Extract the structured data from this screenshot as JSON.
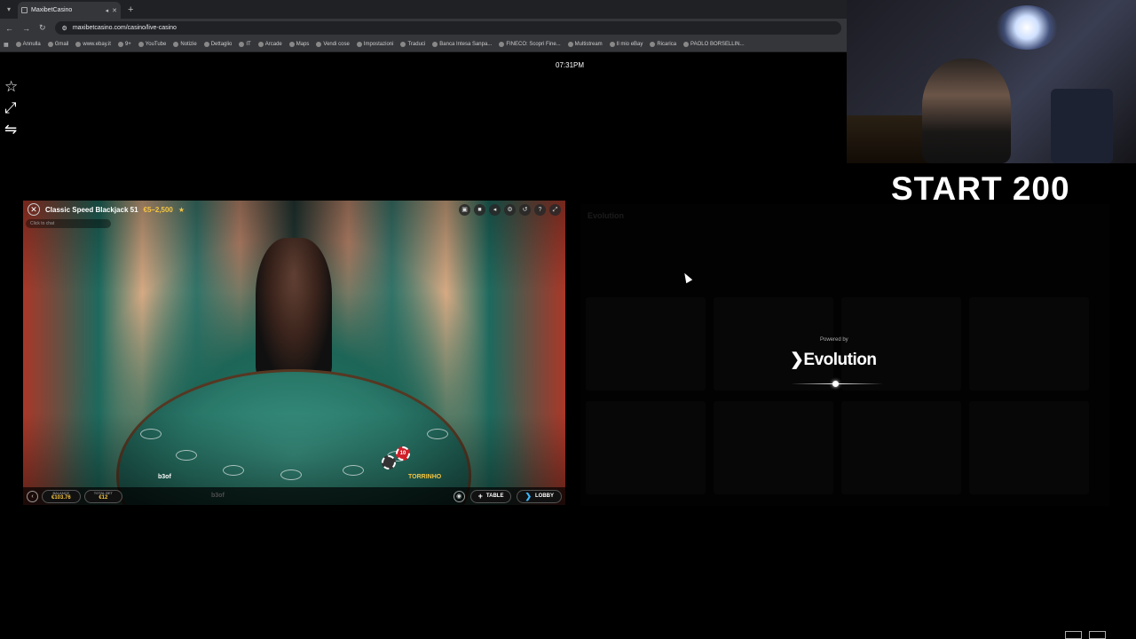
{
  "browser": {
    "tab_title": "MaxibetCasino",
    "url": "maxibetcasino.com/casino/live-casino",
    "bookmarks": [
      "Annulla",
      "Gmail",
      "www.ebay.it",
      "9+",
      "YouTube",
      "Notizie",
      "Dettaglio",
      "IT",
      "Arcade",
      "Maps",
      "Vendi cose",
      "Impostazioni",
      "Traduci",
      "Banca Intesa Sanpa...",
      "FINECO: Scopri Fine...",
      "Multistream",
      "Il mio eBay",
      "Ricarica",
      "PAOLO BORSELLIN..."
    ]
  },
  "clock": "07:31PM",
  "overlay": {
    "start_text": "START 200"
  },
  "game": {
    "title": "Classic Speed Blackjack 51",
    "limits": "€5–2,500",
    "chat_placeholder": "Click to chat",
    "seats": [
      {
        "name": "b3of"
      },
      {
        "name": "b3of"
      },
      {
        "name": "TORRINHO"
      }
    ],
    "chip_value": "10",
    "balance_label": "BALANCE",
    "balance_value": "€103.76",
    "total_bet_label": "TOTAL BET",
    "total_bet_value": "€12",
    "table_button": "TABLE",
    "lobby_button": "LOBBY"
  },
  "loading": {
    "ghost_logo": "Evolution",
    "powered_by": "Powered by",
    "logo_text": "Evolution"
  },
  "colors": {
    "accent_gold": "#f5c542",
    "lobby_blue": "#3fb9ff"
  }
}
